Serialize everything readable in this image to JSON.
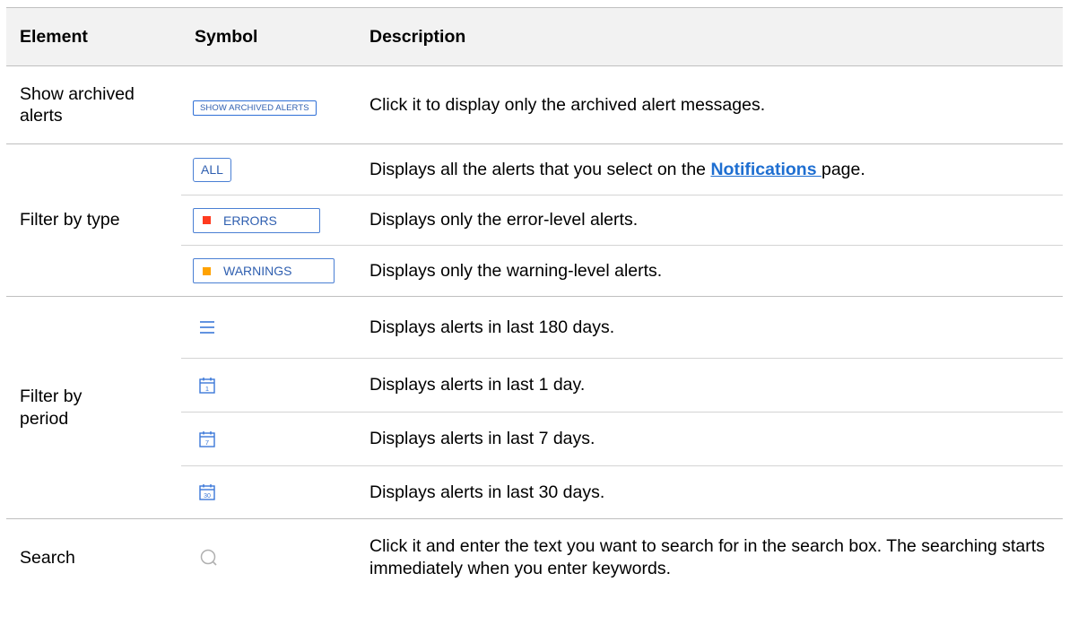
{
  "header": {
    "element": "Element",
    "symbol": "Symbol",
    "description": "Description"
  },
  "rows": {
    "archived": {
      "element": "Show archived alerts",
      "symbol_text": "SHOW ARCHIVED ALERTS",
      "description": "Click it to display only the archived alert messages."
    },
    "type": {
      "element": "Filter by type",
      "all": {
        "symbol_text": "ALL",
        "description_before": "Displays all the alerts that you select on the ",
        "link": "Notifications ",
        "description_after": "page."
      },
      "errors": {
        "symbol_text": "ERRORS",
        "square_color": "#ff3b1f",
        "description": "Displays only the error-level alerts."
      },
      "warnings": {
        "symbol_text": "WARNINGS",
        "square_color": "#ffa200",
        "description": "Displays only the warning-level alerts."
      }
    },
    "period": {
      "element": "Filter by period",
      "list": {
        "icon": "list-icon",
        "description": "Displays alerts in last 180 days."
      },
      "day1": {
        "icon": "calendar-1-icon",
        "icon_number": "1",
        "description": "Displays alerts in last 1 day."
      },
      "day7": {
        "icon": "calendar-7-icon",
        "icon_number": "7",
        "description": "Displays alerts in last 7 days."
      },
      "day30": {
        "icon": "calendar-30-icon",
        "icon_number": "30",
        "description": "Displays alerts in last 30 days."
      }
    },
    "search": {
      "element": "Search",
      "icon": "search-icon",
      "description": "Click it and enter the text you want to search for in the search box. The searching starts immediately when you enter keywords."
    }
  },
  "colors": {
    "accent": "#2f6fd6",
    "link": "#1f6fd1",
    "header_bg": "#f2f2f2"
  }
}
